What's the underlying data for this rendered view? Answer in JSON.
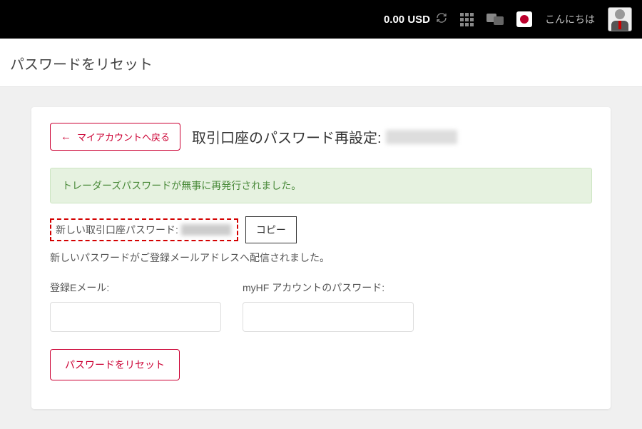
{
  "header": {
    "balance": "0.00 USD",
    "greeting": "こんにちは"
  },
  "page": {
    "title": "パスワードをリセット"
  },
  "card": {
    "back_label": "マイアカウントへ戻る",
    "heading": "取引口座のパスワード再設定:",
    "success_message": "トレーダーズパスワードが無事に再発行されました。",
    "new_password_label": "新しい取引口座パスワード:",
    "copy_label": "コピー",
    "sent_note": "新しいパスワードがご登録メールアドレスへ配信されました。",
    "email_label": "登録Eメール:",
    "myhf_label": "myHF アカウントのパスワード:",
    "reset_label": "パスワードをリセット"
  }
}
